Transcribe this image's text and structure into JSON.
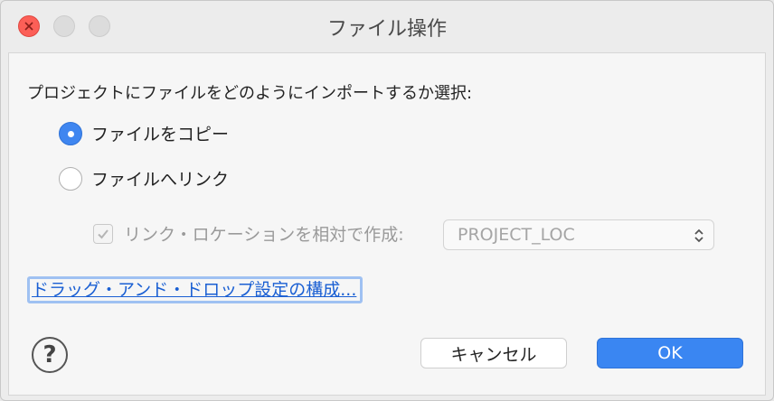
{
  "window": {
    "title": "ファイル操作"
  },
  "dialog": {
    "prompt": "プロジェクトにファイルをどのようにインポートするか選択:",
    "options": [
      {
        "label": "ファイルをコピー",
        "selected": true
      },
      {
        "label": "ファイルへリンク",
        "selected": false
      }
    ],
    "relative_link": {
      "label": "リンク・ロケーションを相対で作成:",
      "checked": true,
      "enabled": false,
      "select_value": "PROJECT_LOC"
    },
    "drag_drop_link": "ドラッグ・アンド・ドロップ設定の構成...",
    "help_glyph": "?",
    "buttons": {
      "cancel": "キャンセル",
      "ok": "OK"
    }
  },
  "colors": {
    "accent": "#3a86f2",
    "close": "#fc5f57",
    "link": "#1a5fd3"
  },
  "icons": {
    "close": "close-icon",
    "help": "help-icon",
    "select_chevron": "chevron-updown-icon"
  }
}
